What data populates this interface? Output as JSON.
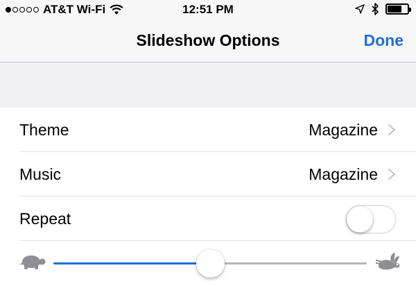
{
  "status_bar": {
    "carrier": "AT&T Wi-Fi",
    "time": "12:51 PM",
    "signal_bars_filled": 1,
    "signal_bars_total": 5,
    "battery_level": 0.7
  },
  "nav": {
    "title": "Slideshow Options",
    "done_label": "Done"
  },
  "colors": {
    "accent": "#1f6fd9",
    "background": "#efeff4"
  },
  "rows": [
    {
      "label": "Theme",
      "value": "Magazine"
    },
    {
      "label": "Music",
      "value": "Magazine"
    },
    {
      "label": "Repeat",
      "toggle_on": false
    }
  ],
  "speed_slider": {
    "min_icon": "turtle-icon",
    "max_icon": "hare-icon",
    "value": 0.5
  }
}
